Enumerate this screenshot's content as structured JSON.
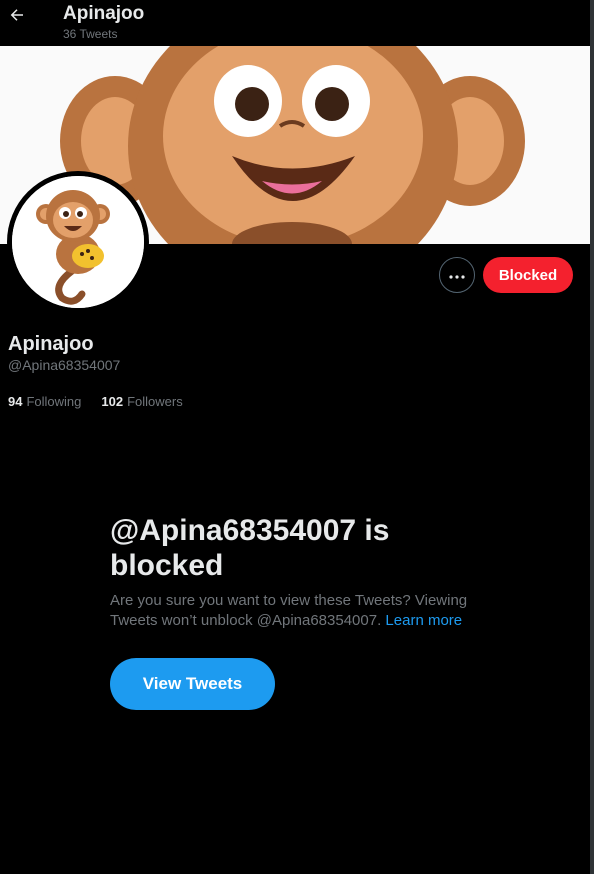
{
  "header": {
    "title": "Apinajoo",
    "tweet_count": "36 Tweets"
  },
  "profile": {
    "display_name": "Apinajoo",
    "handle": "@Apina68354007",
    "following_count": "94",
    "following_label": "Following",
    "followers_count": "102",
    "followers_label": "Followers"
  },
  "actions": {
    "blocked_label": "Blocked"
  },
  "blocked_notice": {
    "title": "@Apina68354007 is blocked",
    "body": "Are you sure you want to view these Tweets? Viewing Tweets won’t unblock @Apina68354007.",
    "learn_more": "Learn more",
    "view_button": "View Tweets"
  },
  "icons": {
    "back": "arrow-left-icon",
    "more": "more-horizontal-icon"
  },
  "colors": {
    "blocked_button": "#f4212e",
    "primary_button": "#1d9bf0",
    "link": "#1d9bf0",
    "secondary_text": "#71767b",
    "background": "#000000"
  }
}
